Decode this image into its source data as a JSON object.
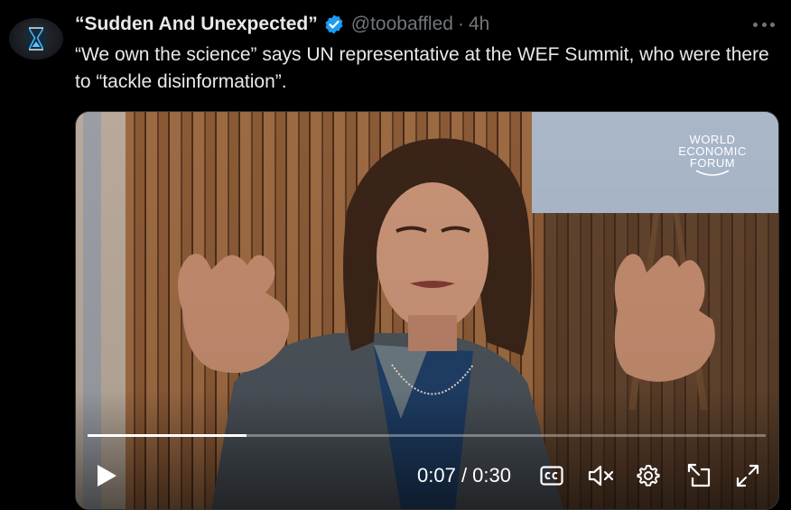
{
  "tweet": {
    "display_name": "“Sudden And Unexpected”",
    "handle": "@toobaffled",
    "separator": "·",
    "time": "4h",
    "text": "“We own the science” says UN representative at the WEF Summit, who were there to “tackle disinformation”."
  },
  "icons": {
    "avatar": "hourglass-icon",
    "verified": "verified-badge-icon",
    "more": "more-options-icon"
  },
  "video": {
    "watermark": [
      "WORLD",
      "ECONOMIC",
      "FORUM"
    ],
    "progress_fraction": 0.235,
    "current_time": "0:07",
    "duration": "0:30",
    "time_separator": " / "
  },
  "colors": {
    "background": "#000000",
    "text_primary": "#e7e9ea",
    "text_secondary": "#71767b",
    "verified": "#1d9bf0"
  }
}
